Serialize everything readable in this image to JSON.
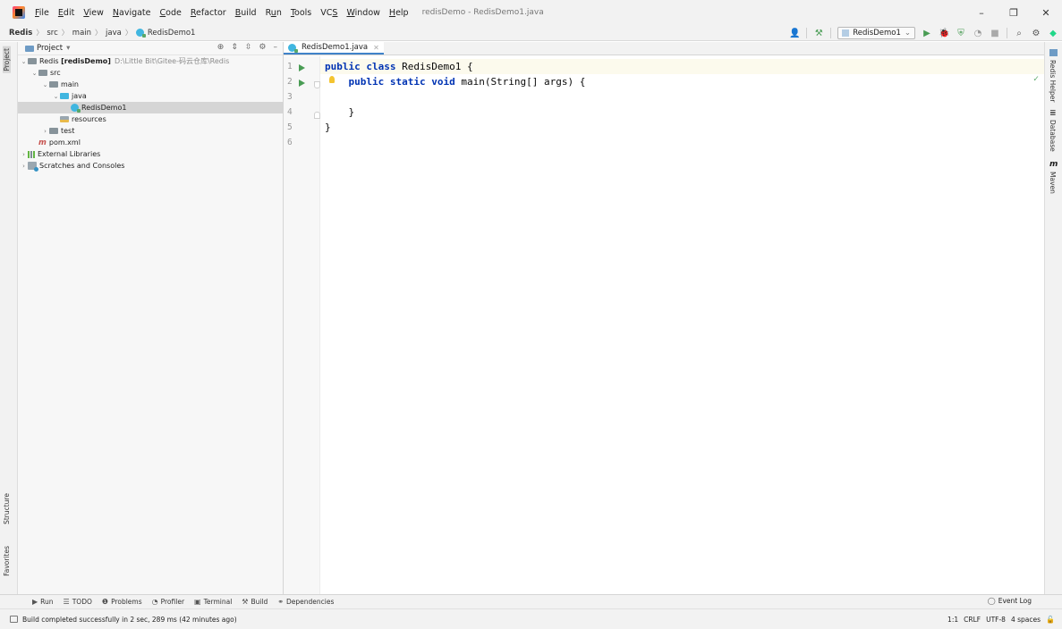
{
  "menubar": {
    "items": [
      "File",
      "Edit",
      "View",
      "Navigate",
      "Code",
      "Refactor",
      "Build",
      "Run",
      "Tools",
      "VCS",
      "Window",
      "Help"
    ],
    "mnemonics": [
      "F",
      "E",
      "V",
      "N",
      "C",
      "R",
      "B",
      "u",
      "T",
      "S",
      "W",
      "H"
    ],
    "window_title": "redisDemo - RedisDemo1.java",
    "minimize": "–",
    "restore": "❐",
    "close": "✕"
  },
  "navbar": {
    "breadcrumbs": [
      "Redis",
      "src",
      "main",
      "java",
      "RedisDemo1"
    ],
    "run_config": "RedisDemo1",
    "icons": [
      "user-icon",
      "hammer-icon",
      "run-icon",
      "debug-icon",
      "coverage-icon",
      "profile-icon",
      "stop-icon",
      "search-icon",
      "settings-icon",
      "plugin-icon"
    ]
  },
  "project_panel": {
    "title": "Project",
    "tree": [
      {
        "label": "Redis",
        "module": "[redisDemo]",
        "path": "D:\\Little Bit\\Gitee-码云仓库\\Redis",
        "arrow": "⌄"
      },
      {
        "label": "src",
        "arrow": "⌄"
      },
      {
        "label": "main",
        "arrow": "⌄"
      },
      {
        "label": "java",
        "arrow": "⌄"
      },
      {
        "label": "RedisDemo1"
      },
      {
        "label": "resources"
      },
      {
        "label": "test",
        "arrow": "›"
      },
      {
        "label": "pom.xml"
      },
      {
        "label": "External Libraries",
        "arrow": "›"
      },
      {
        "label": "Scratches and Consoles",
        "arrow": "›"
      }
    ]
  },
  "left_stripe": {
    "project": "Project",
    "structure": "Structure",
    "favorites": "Favorites"
  },
  "right_stripe": {
    "redis_helper": "Redis Helper",
    "database": "Database",
    "maven": "Maven"
  },
  "editor": {
    "tab": "RedisDemo1.java",
    "line_numbers": [
      "1",
      "2",
      "3",
      "4",
      "5",
      "6"
    ],
    "lines": [
      {
        "kw": "public class",
        "rest": " RedisDemo1 {"
      },
      {
        "kw": "    public static void",
        "rest": " main(String[] args) {"
      },
      {
        "kw": "",
        "rest": ""
      },
      {
        "kw": "",
        "rest": "    }"
      },
      {
        "kw": "",
        "rest": "}"
      },
      {
        "kw": "",
        "rest": ""
      }
    ]
  },
  "bottom_tools": {
    "run": "Run",
    "todo": "TODO",
    "problems": "Problems",
    "profiler": "Profiler",
    "terminal": "Terminal",
    "build": "Build",
    "dependencies": "Dependencies",
    "event_log": "Event Log"
  },
  "statusbar": {
    "message": "Build completed successfully in 2 sec, 289 ms (42 minutes ago)",
    "position": "1:1",
    "line_sep": "CRLF",
    "encoding": "UTF-8",
    "indent": "4 spaces"
  }
}
